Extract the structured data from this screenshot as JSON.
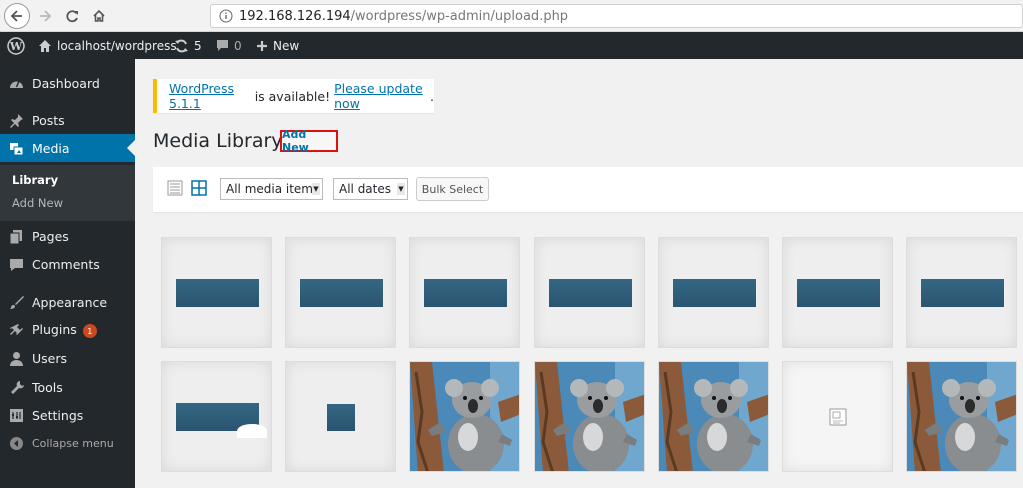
{
  "browser": {
    "url_host": "192.168.126.194",
    "url_path": "/wordpress/wp-admin/upload.php"
  },
  "adminbar": {
    "site": "localhost/wordpress",
    "updates": "5",
    "comments": "0",
    "new": "New"
  },
  "sidebar": {
    "items": [
      {
        "label": "Dashboard",
        "icon": "dashboard-icon"
      },
      {
        "label": "Posts",
        "icon": "pushpin-icon"
      },
      {
        "label": "Media",
        "icon": "media-icon"
      },
      {
        "label": "Pages",
        "icon": "pages-icon"
      },
      {
        "label": "Comments",
        "icon": "comment-icon"
      },
      {
        "label": "Appearance",
        "icon": "brush-icon"
      },
      {
        "label": "Plugins",
        "icon": "plugin-icon",
        "badge": "1"
      },
      {
        "label": "Users",
        "icon": "user-icon"
      },
      {
        "label": "Tools",
        "icon": "wrench-icon"
      },
      {
        "label": "Settings",
        "icon": "settings-icon"
      },
      {
        "label": "Collapse menu",
        "icon": "collapse-icon"
      }
    ],
    "submenu": [
      "Library",
      "Add New"
    ]
  },
  "notice": {
    "link1": "WordPress 5.1.1",
    "text": " is available! ",
    "link2": "Please update now",
    "end": "."
  },
  "page": {
    "title": "Media Library",
    "add_new": "Add New"
  },
  "toolbar": {
    "filter_type": "All media items",
    "filter_date": "All dates",
    "bulk": "Bulk Select"
  },
  "grid": {
    "row1": [
      "blue",
      "blue",
      "blue",
      "blue",
      "blue",
      "blue",
      "blue"
    ],
    "row2": [
      "blue-crop",
      "small",
      "koala",
      "koala",
      "koala",
      "file",
      "koala"
    ]
  },
  "colors": {
    "adminbar": "#23282d",
    "accent": "#0073aa",
    "notice": "#ffb900",
    "badge": "#ca4a1f"
  }
}
